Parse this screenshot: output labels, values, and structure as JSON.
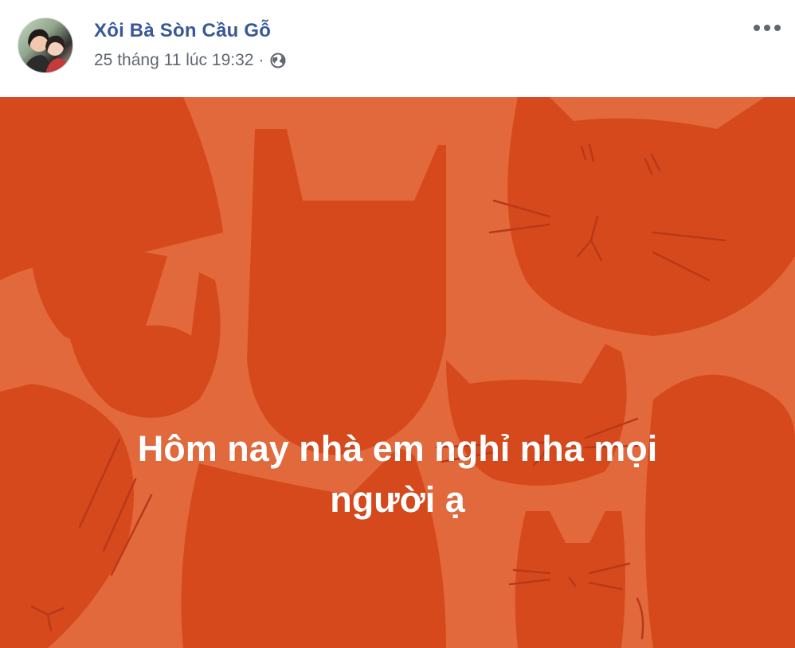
{
  "post": {
    "author": "Xôi Bà Sòn Cầu Gỗ",
    "timestamp": "25 tháng 11 lúc 19:32",
    "separator": "·",
    "privacy_icon": "globe-icon",
    "more_icon": "more-options-icon",
    "status_line1": "Hôm nay nhà em nghỉ nha mọi",
    "status_line2": "người ạ",
    "colors": {
      "author": "#385898",
      "meta": "#606770",
      "background": "#e2693c",
      "shape": "#d6491c",
      "text": "#ffffff"
    }
  }
}
